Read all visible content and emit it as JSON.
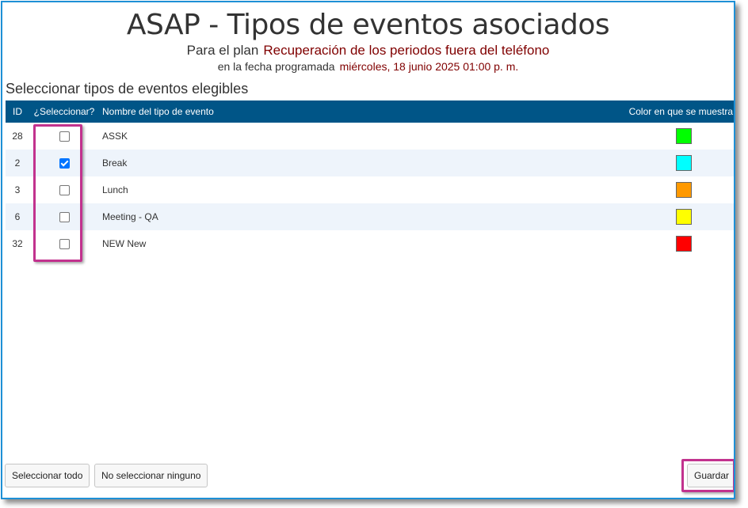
{
  "header": {
    "title": "ASAP - Tipos de eventos asociados",
    "plan_label": "Para el plan",
    "plan_name": "Recuperación de los periodos fuera del teléfono",
    "date_label": "en la fecha programada",
    "date_value": "miércoles, 18 junio 2025 01:00 p. m."
  },
  "section_label": "Seleccionar tipos de eventos elegibles",
  "table": {
    "columns": {
      "id": "ID",
      "select": "¿Seleccionar?",
      "name": "Nombre del tipo de evento",
      "color": "Color en que se muestra"
    },
    "rows": [
      {
        "id": "28",
        "name": "ASSK",
        "checked": false,
        "color": "#00ff00"
      },
      {
        "id": "2",
        "name": "Break",
        "checked": true,
        "color": "#00ffff"
      },
      {
        "id": "3",
        "name": "Lunch",
        "checked": false,
        "color": "#ff9900"
      },
      {
        "id": "6",
        "name": "Meeting - QA",
        "checked": false,
        "color": "#ffff00"
      },
      {
        "id": "32",
        "name": "NEW New",
        "checked": false,
        "color": "#ff0000"
      }
    ]
  },
  "buttons": {
    "select_all": "Seleccionar todo",
    "select_none": "No seleccionar ninguno",
    "save": "Guardar"
  },
  "colors": {
    "header_bg": "#005587",
    "accent_text": "#800000",
    "highlight": "#c2328e",
    "window_border": "#1e90d6"
  }
}
